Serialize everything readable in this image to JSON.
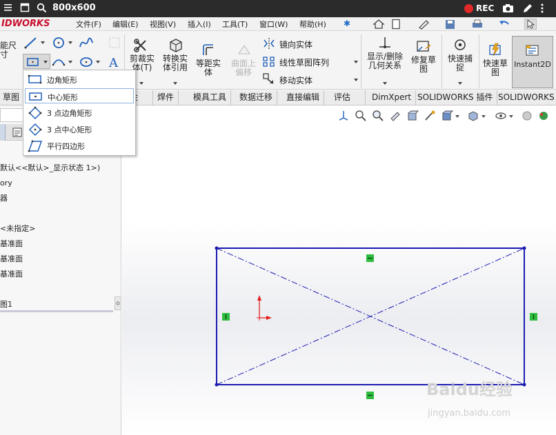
{
  "recorder": {
    "title": "800x600",
    "status": "REC"
  },
  "brand": "IDWORKS",
  "menu": {
    "items": [
      "文件(F)",
      "编辑(E)",
      "视图(V)",
      "插入(I)",
      "工具(T)",
      "窗口(W)",
      "帮助(H)"
    ]
  },
  "ribbon": {
    "smart_dim": "能尺\n寸",
    "trim": "剪裁实\n体(T)",
    "convert": "转换实\n体引用",
    "offset": "等距实\n体",
    "surface_offset": "曲面上\n偏移",
    "mirror": "镜向实体",
    "linear_pattern": "线性草图阵列",
    "move": "移动实体",
    "relations": "显示/删除\n几何关系",
    "repair": "修复草\n图",
    "quick_snaps": "快速捕\n捉",
    "rapid_sketch": "快速草\n图",
    "instant2d": "Instant2D"
  },
  "tabs": [
    "草图",
    "金",
    "焊件",
    "模具工具",
    "数据迁移",
    "直接编辑",
    "评估",
    "DimXpert",
    "SOLIDWORKS 插件",
    "SOLIDWORKS M"
  ],
  "rect_menu": {
    "items": [
      "边角矩形",
      "中心矩形",
      "3 点边角矩形",
      "3 点中心矩形",
      "平行四边形"
    ]
  },
  "tree": {
    "items": [
      "默认<<默认>_显示状态 1>)",
      "ory",
      "器",
      "<未指定>",
      "基准面",
      "基准面",
      "基准面",
      "图1"
    ]
  },
  "watermark": {
    "brand": "Baidu经验",
    "url": "jingyan.baidu.com"
  },
  "colors": {
    "sketch_line": "#1a1ab0",
    "relation_marker": "#2ebd3f",
    "origin": "#e0201f",
    "rec_dot": "#e02828"
  }
}
